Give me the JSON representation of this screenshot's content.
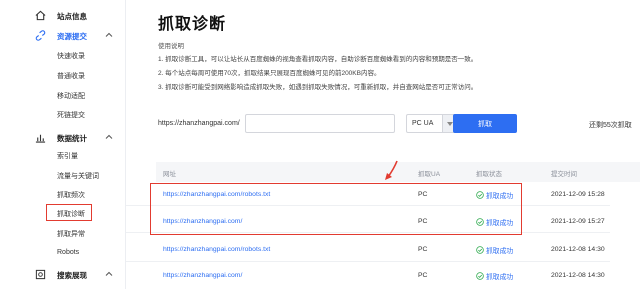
{
  "sidebar": {
    "groups": [
      {
        "label": "站点信息",
        "icon": "home-icon"
      },
      {
        "label": "资源提交",
        "icon": "link-icon"
      },
      {
        "label": "数据统计",
        "icon": "bar-chart-icon"
      },
      {
        "label": "搜索展现",
        "icon": "search-display-icon"
      }
    ],
    "resource_items": [
      "快速收录",
      "普通收录",
      "移动适配",
      "死链提交"
    ],
    "stats_items": [
      "索引量",
      "流量与关键词",
      "抓取频次",
      "抓取诊断",
      "抓取异常",
      "Robots"
    ]
  },
  "main": {
    "title": "抓取诊断",
    "usage_title": "使用说明",
    "usage_lines": [
      "1. 抓取诊断工具，可以让站长从百度蜘蛛的视角查看抓取内容，自助诊断百度蜘蛛看到的内容和预期是否一致。",
      "2. 每个站点每周可使用70次，抓取结果只展现百度蜘蛛可见的前200KB内容。",
      "3. 抓取诊断可能受到网络影响造成抓取失败，如遇到抓取失败情况，可重新抓取，并自查网站是否可正常访问。"
    ],
    "url_prefix": "https://zhanzhangpai.com/",
    "url_input_value": "",
    "ua_select": "PC UA",
    "fetch_button": "抓取",
    "remaining": "还剩55次抓取"
  },
  "table": {
    "headers": {
      "url": "网址",
      "ua": "抓取UA",
      "status": "抓取状态",
      "time": "提交时间"
    },
    "rows": [
      {
        "url": "https://zhanzhangpai.com/robots.txt",
        "ua": "PC",
        "status": "抓取成功",
        "time": "2021-12-09 15:28"
      },
      {
        "url": "https://zhanzhangpai.com/",
        "ua": "PC",
        "status": "抓取成功",
        "time": "2021-12-09 15:27"
      },
      {
        "url": "https://zhanzhangpai.com/robots.txt",
        "ua": "PC",
        "status": "抓取成功",
        "time": "2021-12-08 14:30"
      },
      {
        "url": "https://zhanzhangpai.com/",
        "ua": "PC",
        "status": "抓取成功",
        "time": "2021-12-08 14:30"
      }
    ]
  },
  "colors": {
    "accent": "#2d6ef2",
    "highlight_box": "#e23b30",
    "success": "#2eaa4e"
  }
}
